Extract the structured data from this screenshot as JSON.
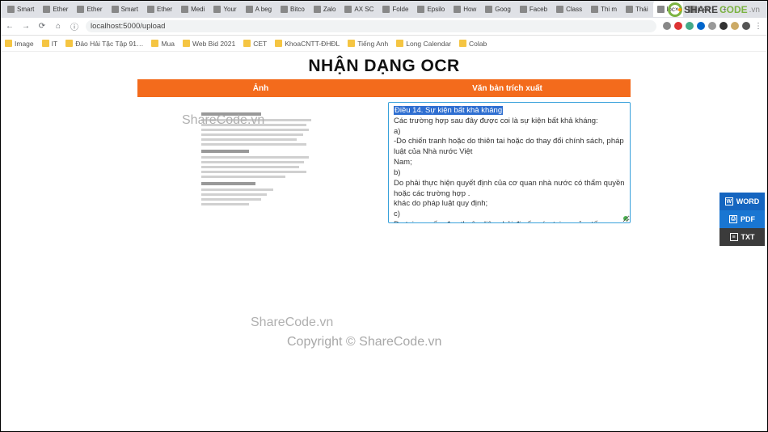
{
  "browser": {
    "tabs": [
      {
        "label": "Smart"
      },
      {
        "label": "Ether"
      },
      {
        "label": "Ether"
      },
      {
        "label": "Smart"
      },
      {
        "label": "Ether"
      },
      {
        "label": "Medi"
      },
      {
        "label": "Your"
      },
      {
        "label": "A beg"
      },
      {
        "label": "Bitco"
      },
      {
        "label": "Zalo"
      },
      {
        "label": "AX SC"
      },
      {
        "label": "Folde"
      },
      {
        "label": "Epsilo"
      },
      {
        "label": "How"
      },
      {
        "label": "Goog"
      },
      {
        "label": "Faceb"
      },
      {
        "label": "Class"
      },
      {
        "label": "Thi m"
      },
      {
        "label": "Thái"
      },
      {
        "label": "loc",
        "active": true
      },
      {
        "label": "Kiến t"
      }
    ],
    "url": "localhost:5000/upload",
    "bookmarks": [
      "Image",
      "IT",
      "Đảo Hải Tặc Tập 91…",
      "Mua",
      "Web Bid 2021",
      "CET",
      "KhoaCNTT-ĐHĐL",
      "Tiếng Anh",
      "Long Calendar",
      "Colab"
    ]
  },
  "page": {
    "title": "NHẬN DẠNG OCR",
    "col_left": "Ảnh",
    "col_right": "Văn bản trích xuất"
  },
  "extracted_text": {
    "highlight": "Điều 14. Sự kiện bất khả kháng",
    "lines": [
      "Các trường hợp sau đây được coi là sự kiện bất khả kháng:",
      "a)",
      "-Do chiến tranh hoặc do thiên tai hoặc do thay đổi chính sách, pháp luật của Nhà nước Việt",
      "Nam;",
      "b)",
      "Do phải thực hiện quyết định của cơ quan nhà nước có thẩm quyền hoặc các trường hợp .",
      "khác do pháp luật quy định;",
      "c)",
      "Do tai nạn, ốm đau thuộc diện phải đi cấp cứu tại cơ sở y tế;"
    ]
  },
  "export": {
    "word": "WORD",
    "pdf": "PDF",
    "txt": "TXT"
  },
  "watermark": {
    "brand_a": "SHARE",
    "brand_b": "CODE",
    "brand_c": ".vn",
    "mid": "ShareCode.vn",
    "copy": "Copyright © ShareCode.vn"
  }
}
